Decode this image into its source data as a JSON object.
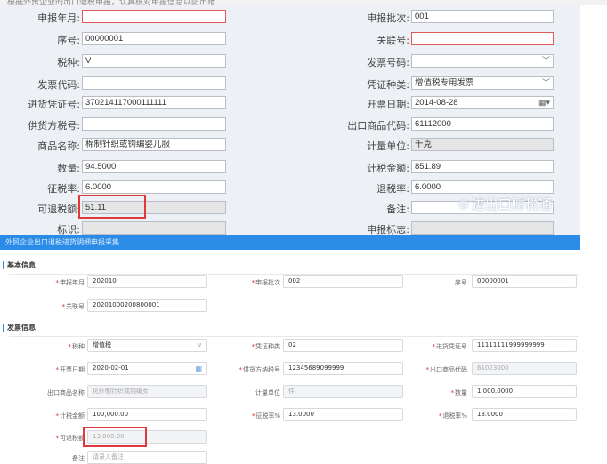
{
  "top_caption": "根据外贸企业的出口退税申报，认真核对申报信息以防出错",
  "old_form": {
    "left": [
      {
        "label": "申报年月:",
        "value": ""
      },
      {
        "label": "序号:",
        "value": "00000001"
      },
      {
        "label": "税种:",
        "value": "V"
      },
      {
        "label": "发票代码:",
        "value": ""
      },
      {
        "label": "进货凭证号:",
        "value": "370214117000111111"
      },
      {
        "label": "供货方税号:",
        "value": ""
      },
      {
        "label": "商品名称:",
        "value": "棉制针织或钩编婴儿服"
      },
      {
        "label": "数量:",
        "value": "94.5000"
      },
      {
        "label": "征税率:",
        "value": "6.0000"
      },
      {
        "label": "可退税额:",
        "value": "51.11"
      },
      {
        "label": "标识:",
        "value": ""
      }
    ],
    "right": [
      {
        "label": "申报批次:",
        "value": "001"
      },
      {
        "label": "关联号:",
        "value": ""
      },
      {
        "label": "发票号码:",
        "value": ""
      },
      {
        "label": "凭证种类:",
        "value": "增值税专用发票"
      },
      {
        "label": "开票日期:",
        "value": "2014-08-28"
      },
      {
        "label": "出口商品代码:",
        "value": "61112000"
      },
      {
        "label": "计量单位:",
        "value": "千克"
      },
      {
        "label": "计税金额:",
        "value": "851.89"
      },
      {
        "label": "退税率:",
        "value": "6.0000"
      },
      {
        "label": "备注:",
        "value": ""
      },
      {
        "label": "申报标志:",
        "value": ""
      }
    ],
    "watermark": "进出口财税通"
  },
  "new_header": "外贸企业出口退税进货明细申报采集",
  "new_form": {
    "basic_section": "基本信息",
    "invoice_section": "发票信息",
    "fields": {
      "sbny": {
        "label": "申报年月",
        "value": "202010"
      },
      "sbpc": {
        "label": "申报批次",
        "value": "002"
      },
      "xh": {
        "label": "序号",
        "value": "00000001"
      },
      "glh": {
        "label": "关联号",
        "value": "20201000200800001"
      },
      "sz": {
        "label": "税种",
        "value": "增值税"
      },
      "pzzl": {
        "label": "凭证种类",
        "value": "02"
      },
      "jhpzh": {
        "label": "进货凭证号",
        "value": "11111111999999999"
      },
      "kprq": {
        "label": "开票日期",
        "value": "2020-02-01"
      },
      "ghfnsrh": {
        "label": "供货方纳税号",
        "value": "12345689099999"
      },
      "ckspdm": {
        "label": "出口商品代码",
        "value": "61023000"
      },
      "ckspmc": {
        "label": "出口商品名称",
        "value": "化纤制针织或钩编女"
      },
      "jldw": {
        "label": "计量单位",
        "value": "件"
      },
      "sl": {
        "label": "数量",
        "value": "1,000.0000"
      },
      "jsje": {
        "label": "计税金额",
        "value": "100,000.00"
      },
      "zsl": {
        "label": "征税率%",
        "value": "13.0000"
      },
      "tsl": {
        "label": "退税率%",
        "value": "13.0000"
      },
      "kdse": {
        "label": "可退税额",
        "value": "13,000.00"
      },
      "bz": {
        "label": "备注",
        "placeholder": "请录入备注"
      }
    }
  },
  "colors": {
    "accent": "#2b8ce8",
    "highlight": "#e0393b",
    "required": "#e02020"
  }
}
